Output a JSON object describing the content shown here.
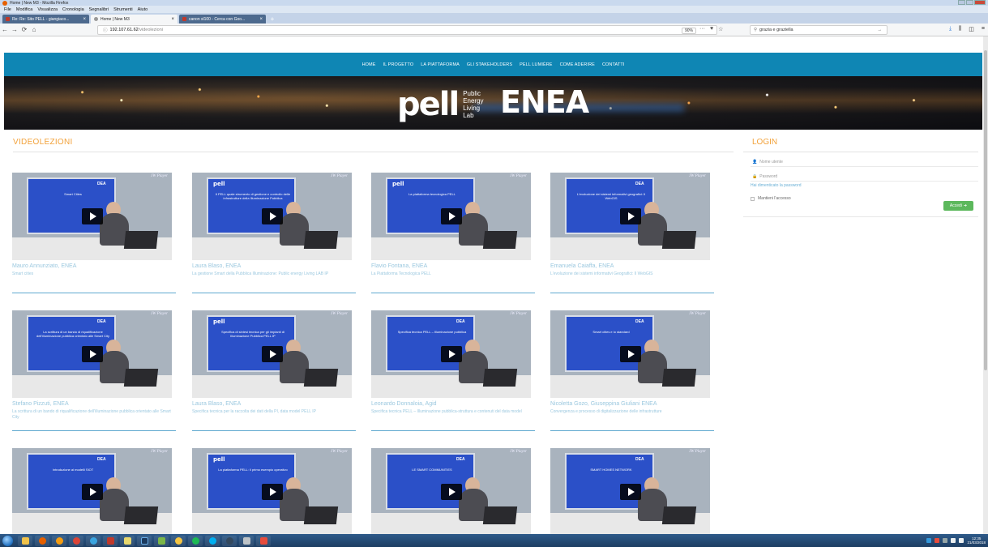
{
  "window": {
    "title": "Home | New M3 - Mozilla Firefox"
  },
  "menubar": [
    "File",
    "Modifica",
    "Visualizza",
    "Cronologia",
    "Segnalibri",
    "Strumenti",
    "Aiuto"
  ],
  "tabs": [
    {
      "label": "Re: Re: Sito PELL - giangiaco...",
      "active": false
    },
    {
      "label": "Home | New M3",
      "active": true
    },
    {
      "label": "canon sl100 - Cerca con Goo...",
      "active": false
    }
  ],
  "navbar": {
    "url_host": "192.107.61.62",
    "url_path": "/videolezioni",
    "zoom": "90%",
    "search_value": "grazia e graziella"
  },
  "site": {
    "nav": [
      "HOME",
      "IL PROGETTO",
      "LA PIATTAFORMA",
      "GLI STAKEHOLDERS",
      "PELL LUMIÈRE",
      "COME ADERIRE",
      "CONTATTI"
    ],
    "banner": {
      "pell": "pell",
      "pell_sub": [
        "Public",
        "Energy",
        "Living",
        "Lab"
      ],
      "enea": "ENEA"
    },
    "page_title": "VIDEOLEZIONI",
    "videos": [
      {
        "name": "Mauro Annunziato, ENEA",
        "desc": "Smart cities",
        "slide": "Smart Cities",
        "brand": "DEA"
      },
      {
        "name": "Laura Blaso, ENEA",
        "desc": "La gestione Smart della Pubblica Illuminazione: Public energy Living LAB IP",
        "slide": "Il PELL quale strumento di gestione e controllo delle infrastrutture della Illuminazione Pubblica",
        "brand": "pell"
      },
      {
        "name": "Flavio Fontana, ENEA",
        "desc": "La Piattaforma Tecnologica PELL",
        "slide": "La piattaforma tecnologica PELL",
        "brand": "pell"
      },
      {
        "name": "Emanuela Caiaffa, ENEA",
        "desc": "L'evoluzione dei sistemi informativi Geografici: Il WebGIS",
        "slide": "L'evoluzione dei sistemi informativi geografici: Il WebGIS",
        "brand": "DEA"
      },
      {
        "name": "Stefano Pizzuti, ENEA",
        "desc": "La scrittura di un bando di riqualificazione dell'illuminazione pubblica orientato alle Smart City",
        "slide": "La scrittura di un bando di riqualificazione dell'illuminazione pubblica orientato alle Smart City",
        "brand": "DEA"
      },
      {
        "name": "Laura Blaso, ENEA",
        "desc": "Specifica tecnica per la raccolta dei dati della PI, data model PELL IP",
        "slide": "Specifica di sintesi tecnica per gli impianti di Illuminazione Pubblica PELL IP",
        "brand": "pell"
      },
      {
        "name": "Leonardo Donnaloia, Agid",
        "desc": "Specifica tecnica PELL – Illuminazione pubblica-struttura e contenuti del data model",
        "slide": "Specifica tecnica PELL – Illuminazione pubblica",
        "brand": "DEA"
      },
      {
        "name": "Nicoletta Gozo, Giuseppina Giuliani ENEA",
        "desc": "Convergenza e processo di digitalizzazione delle infrastrutture",
        "slide": "Smart cities e lo standard",
        "brand": "DEA"
      },
      {
        "name": "",
        "desc": "",
        "slide": "Introduzione ai modelli SIOT",
        "brand": "DEA"
      },
      {
        "name": "",
        "desc": "",
        "slide": "La piattaforma PELL: il primo esempio operativo",
        "brand": "pell"
      },
      {
        "name": "",
        "desc": "",
        "slide": "LE SMART COMMUNITIES",
        "brand": "DEA"
      },
      {
        "name": "",
        "desc": "",
        "slide": "SMART HOMES NETWORK",
        "brand": "DEA"
      }
    ],
    "player_label": "JW Player",
    "login": {
      "title": "LOGIN",
      "username_placeholder": "Nome utente",
      "password_placeholder": "Password",
      "forgot": "Hai dimenticato la password",
      "remember": "Mantieni l'accesso",
      "submit": "Accedi"
    }
  },
  "taskbar": {
    "time": "12:35",
    "date": "21/03/2018"
  },
  "colors": {
    "nav_bg": "#0f86b4",
    "title_orange": "#f2a23b",
    "link_blue": "#9bc8df",
    "login_green": "#5cb85c"
  }
}
